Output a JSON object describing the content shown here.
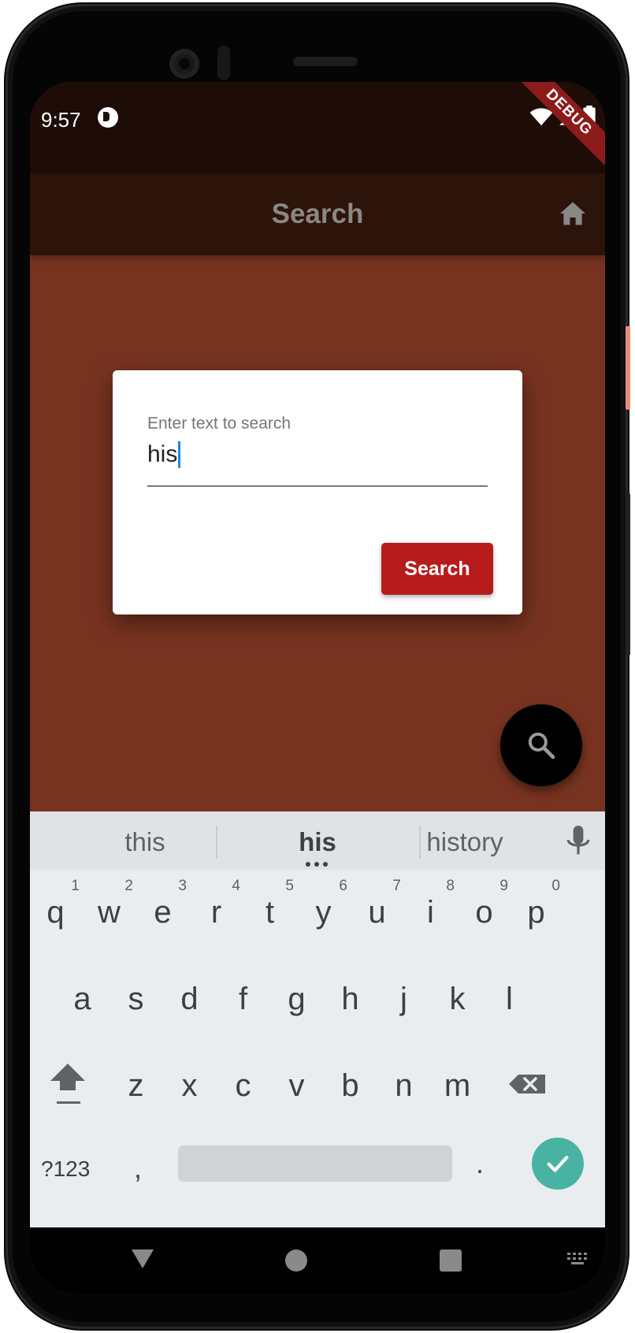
{
  "status_bar": {
    "time": "9:57",
    "debug_label": "DEBUG"
  },
  "app_bar": {
    "title": "Search",
    "home_icon": "home-icon"
  },
  "dialog": {
    "field_label": "Enter text to search",
    "field_value": "his",
    "button_label": "Search"
  },
  "fab": {
    "icon": "search-icon"
  },
  "keyboard": {
    "suggestions": [
      "this",
      "his",
      "history"
    ],
    "rows": [
      [
        {
          "key": "q",
          "hint": "1"
        },
        {
          "key": "w",
          "hint": "2"
        },
        {
          "key": "e",
          "hint": "3"
        },
        {
          "key": "r",
          "hint": "4"
        },
        {
          "key": "t",
          "hint": "5"
        },
        {
          "key": "y",
          "hint": "6"
        },
        {
          "key": "u",
          "hint": "7"
        },
        {
          "key": "i",
          "hint": "8"
        },
        {
          "key": "o",
          "hint": "9"
        },
        {
          "key": "p",
          "hint": "0"
        }
      ],
      [
        {
          "key": "a"
        },
        {
          "key": "s"
        },
        {
          "key": "d"
        },
        {
          "key": "f"
        },
        {
          "key": "g"
        },
        {
          "key": "h"
        },
        {
          "key": "j"
        },
        {
          "key": "k"
        },
        {
          "key": "l"
        }
      ],
      [
        {
          "key": "z"
        },
        {
          "key": "x"
        },
        {
          "key": "c"
        },
        {
          "key": "v"
        },
        {
          "key": "b"
        },
        {
          "key": "n"
        },
        {
          "key": "m"
        }
      ]
    ],
    "symbols_label": "?123",
    "comma": ",",
    "period": "."
  },
  "colors": {
    "status_bar": "#1e0d06",
    "app_bar": "#2c140a",
    "background": "#783320",
    "button": "#b71c1c",
    "fab": "#000000",
    "keyboard": "#e9edf0",
    "enter_key": "#49b3a3"
  }
}
